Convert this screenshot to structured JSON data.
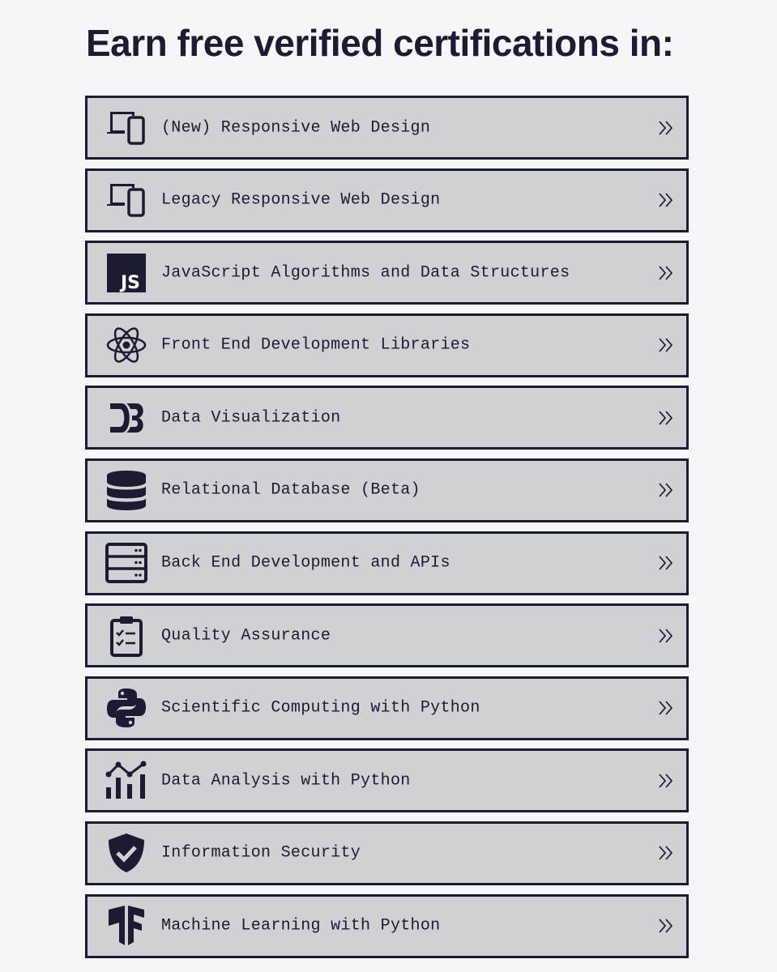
{
  "heading": "Earn free verified certifications in:",
  "colors": {
    "background": "#f5f6f8",
    "card": "#d0d0d5",
    "ink": "#1b1b32"
  },
  "certifications": [
    {
      "label": "(New) Responsive Web Design",
      "icon": "responsive-design-icon"
    },
    {
      "label": "Legacy Responsive Web Design",
      "icon": "responsive-design-icon"
    },
    {
      "label": "JavaScript Algorithms and Data Structures",
      "icon": "javascript-icon"
    },
    {
      "label": "Front End Development Libraries",
      "icon": "react-icon"
    },
    {
      "label": "Data Visualization",
      "icon": "d3-icon"
    },
    {
      "label": "Relational Database (Beta)",
      "icon": "database-icon"
    },
    {
      "label": "Back End Development and APIs",
      "icon": "server-icon"
    },
    {
      "label": "Quality Assurance",
      "icon": "clipboard-check-icon"
    },
    {
      "label": "Scientific Computing with Python",
      "icon": "python-icon"
    },
    {
      "label": "Data Analysis with Python",
      "icon": "analytics-chart-icon"
    },
    {
      "label": "Information Security",
      "icon": "shield-check-icon"
    },
    {
      "label": "Machine Learning with Python",
      "icon": "tensorflow-icon"
    }
  ],
  "arrow_icon": "double-chevron-right-icon"
}
